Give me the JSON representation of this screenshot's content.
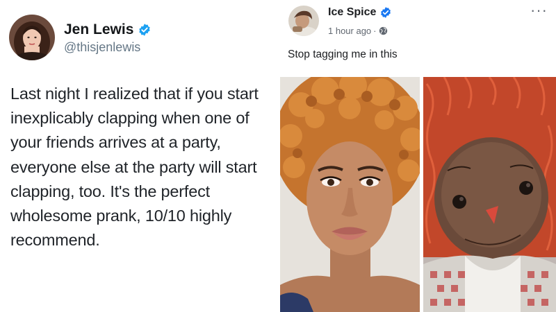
{
  "tweet": {
    "author_name": "Jen Lewis",
    "author_handle": "@thisjenlewis",
    "body": "Last night I realized that if you start inexplicably clapping when one of your friends arrives at a party, everyone else at the party will start clapping, too. It's the perfect wholesome prank, 10/10 highly recommend.",
    "verified_icon": "verified-badge-icon",
    "accent_color": "#1da1f2"
  },
  "facebook_post": {
    "author_name": "Ice Spice",
    "timestamp": "1 hour ago",
    "separator": "·",
    "privacy_icon": "globe-icon",
    "more_label": "···",
    "caption": "Stop tagging me in this",
    "verified_color": "#1877f2",
    "images": [
      {
        "subject": "woman-with-curly-orange-hair"
      },
      {
        "subject": "rag-doll-with-red-yarn-hair"
      }
    ]
  }
}
